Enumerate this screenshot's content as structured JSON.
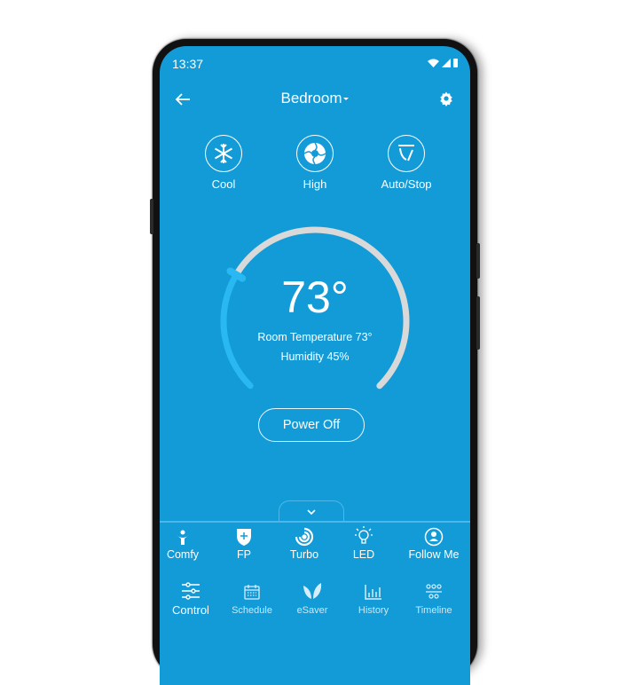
{
  "status_bar": {
    "time": "13:37"
  },
  "app_bar": {
    "title": "Bedroom"
  },
  "modes": [
    {
      "label": "Cool",
      "icon": "snowflake-icon"
    },
    {
      "label": "High",
      "icon": "fan-icon"
    },
    {
      "label": "Auto/Stop",
      "icon": "swing-icon"
    }
  ],
  "thermostat": {
    "setpoint": "73°",
    "room_temperature": "Room Temperature 73°",
    "humidity": "Humidity 45%",
    "dial_fraction": 0.28,
    "colors": {
      "active": "#29b8f2",
      "track": "#d9d9d9"
    }
  },
  "power_button": {
    "label": "Power Off"
  },
  "features": [
    {
      "label": "Comfy",
      "icon": "comfy-person-icon"
    },
    {
      "label": "FP",
      "icon": "shield-icon"
    },
    {
      "label": "Turbo",
      "icon": "turbo-swirl-icon"
    },
    {
      "label": "LED",
      "icon": "bulb-icon"
    },
    {
      "label": "Follow Me",
      "icon": "user-circle-icon"
    }
  ],
  "bottom_nav": [
    {
      "label": "Control",
      "icon": "sliders-icon",
      "active": true
    },
    {
      "label": "Schedule",
      "icon": "calendar-icon",
      "active": false
    },
    {
      "label": "eSaver",
      "icon": "leaf-icon",
      "active": false
    },
    {
      "label": "History",
      "icon": "bar-chart-icon",
      "active": false
    },
    {
      "label": "Timeline",
      "icon": "timeline-icon",
      "active": false
    }
  ],
  "colors": {
    "background": "#139bd8",
    "accent": "#29b8f2"
  }
}
